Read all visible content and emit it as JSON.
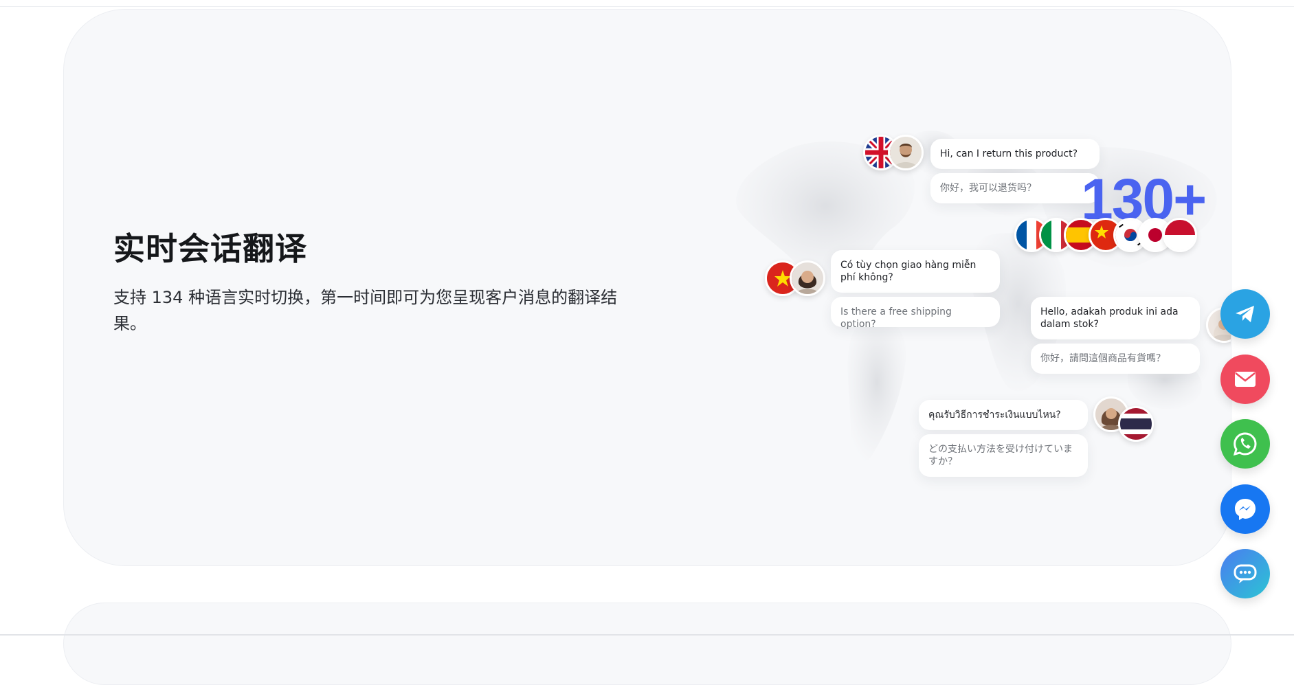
{
  "section": {
    "title": "实时会话翻译",
    "description": "支持 134 种语言实时切换，第一时间即可为您呈现客户消息的翻译结果。"
  },
  "stat": {
    "value": "130+"
  },
  "chats": [
    {
      "original": "Hi, can I return this product?",
      "translation": "你好，我可以退货吗？"
    },
    {
      "original": "Có tùy chọn giao hàng miễn phí không?",
      "translation": "Is there a free shipping option?"
    },
    {
      "original": "Hello, adakah produk ini ada dalam stok?",
      "translation": "你好，請問這個商品有貨嗎？"
    },
    {
      "original": "คุณรับวิธีการชำระเงินแบบไหน?",
      "translation": "どの支払い方法を受け付けていますか？"
    }
  ],
  "flags_row": [
    "france-flag",
    "italy-flag",
    "spain-flag",
    "china-flag",
    "korea-flag",
    "japan-flag",
    "indonesia-flag"
  ],
  "fabs": [
    {
      "name": "telegram-button",
      "icon": "telegram-icon",
      "color": "#2aa3e3"
    },
    {
      "name": "email-button",
      "icon": "mail-icon",
      "color": "#f04a5e"
    },
    {
      "name": "whatsapp-button",
      "icon": "whatsapp-icon",
      "color": "#3fc04e"
    },
    {
      "name": "messenger-button",
      "icon": "messenger-icon",
      "color": "#1777f2"
    },
    {
      "name": "chat-support-button",
      "icon": "chat-bubble-icon",
      "color": "#29b6e0"
    }
  ],
  "colors": {
    "accent": "#4a63f0",
    "card_bg": "#f7f8fa"
  }
}
